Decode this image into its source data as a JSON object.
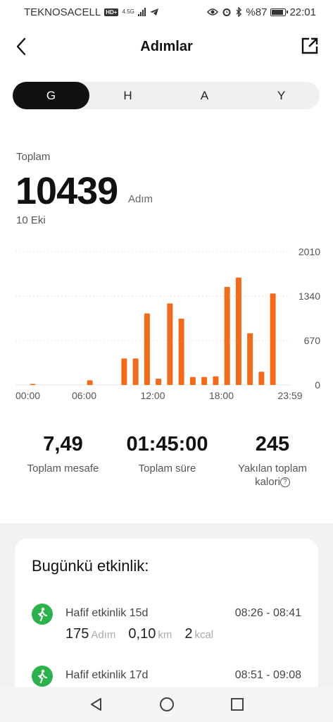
{
  "status_bar": {
    "carrier": "TEKNOSACELL",
    "hd_badge": "HD+",
    "network": "4.5G",
    "battery": "%87",
    "time": "22:01",
    "icons": [
      "signal-icon",
      "telegram-icon",
      "eye-icon",
      "alarm-icon",
      "bluetooth-icon",
      "battery-icon"
    ]
  },
  "header": {
    "title": "Adımlar",
    "back_icon": "chevron-left-icon",
    "share_icon": "share-icon"
  },
  "tabs": [
    {
      "label": "G",
      "active": true
    },
    {
      "label": "H",
      "active": false
    },
    {
      "label": "A",
      "active": false
    },
    {
      "label": "Y",
      "active": false
    }
  ],
  "summary": {
    "label": "Toplam",
    "value": "10439",
    "unit": "Adım",
    "date": "10 Eki"
  },
  "chart_data": {
    "type": "bar",
    "x_tick_labels": [
      "00:00",
      "06:00",
      "12:00",
      "18:00",
      "23:59"
    ],
    "y_tick_labels": [
      "2010",
      "1340",
      "670",
      "0"
    ],
    "ylim": [
      0,
      2010
    ],
    "bar_color": "#f26a1b",
    "grid": true,
    "points": [
      {
        "x": 1,
        "y": 8
      },
      {
        "x": 6,
        "y": 70
      },
      {
        "x": 9,
        "y": 400
      },
      {
        "x": 10,
        "y": 400
      },
      {
        "x": 11,
        "y": 1080
      },
      {
        "x": 12,
        "y": 95
      },
      {
        "x": 13,
        "y": 1230
      },
      {
        "x": 14,
        "y": 1000
      },
      {
        "x": 15,
        "y": 120
      },
      {
        "x": 16,
        "y": 120
      },
      {
        "x": 17,
        "y": 130
      },
      {
        "x": 18,
        "y": 1480
      },
      {
        "x": 19,
        "y": 1620
      },
      {
        "x": 20,
        "y": 780
      },
      {
        "x": 21,
        "y": 200
      },
      {
        "x": 22,
        "y": 1380
      }
    ]
  },
  "stats": [
    {
      "value": "7,49",
      "label": "Toplam mesafe"
    },
    {
      "value": "01:45:00",
      "label": "Toplam süre"
    },
    {
      "value": "245",
      "label": "Yakılan toplam",
      "label2": "kalori"
    }
  ],
  "activity": {
    "title": "Bugünkü etkinlik:",
    "items": [
      {
        "name": "Hafif etkinlik 15d",
        "time": "08:26 - 08:41",
        "steps": "175",
        "steps_unit": "Adım",
        "distance": "0,10",
        "distance_unit": "km",
        "calories": "2",
        "calories_unit": "kcal"
      },
      {
        "name": "Hafif etkinlik 17d",
        "time": "08:51 - 09:08"
      }
    ]
  },
  "nav": {
    "icons": [
      "back-triangle-icon",
      "home-circle-icon",
      "recents-square-icon"
    ]
  }
}
